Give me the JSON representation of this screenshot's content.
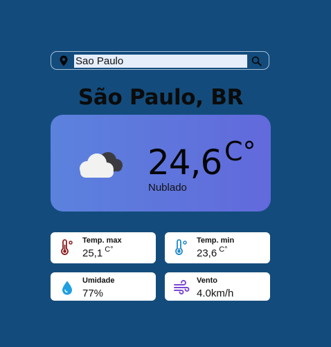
{
  "search": {
    "value": "Sao Paulo",
    "pin_icon": "location-pin-icon",
    "search_icon": "magnifier-icon"
  },
  "city": "São Paulo, BR",
  "current": {
    "temperature": "24,6",
    "unit": "C°",
    "description": "Nublado",
    "icon": "cloudy-icon"
  },
  "details": {
    "temp_max": {
      "label": "Temp. max",
      "value": "25,1",
      "unit": "C°",
      "icon": "thermometer-hot-icon",
      "color": "#8b1e1e"
    },
    "temp_min": {
      "label": "Temp. min",
      "value": "23,6",
      "unit": "C°",
      "icon": "thermometer-cold-icon",
      "color": "#1f88c9"
    },
    "humidity": {
      "label": "Umidade",
      "value": "77%",
      "icon": "water-drop-icon",
      "color": "#1e9fe0"
    },
    "wind": {
      "label": "Vento",
      "value": "4.0km/h",
      "icon": "wind-icon",
      "color": "#7a45d6"
    }
  },
  "colors": {
    "background": "#134c7c",
    "card_gradient_start": "#5b82dd",
    "card_gradient_end": "#6269dc"
  }
}
